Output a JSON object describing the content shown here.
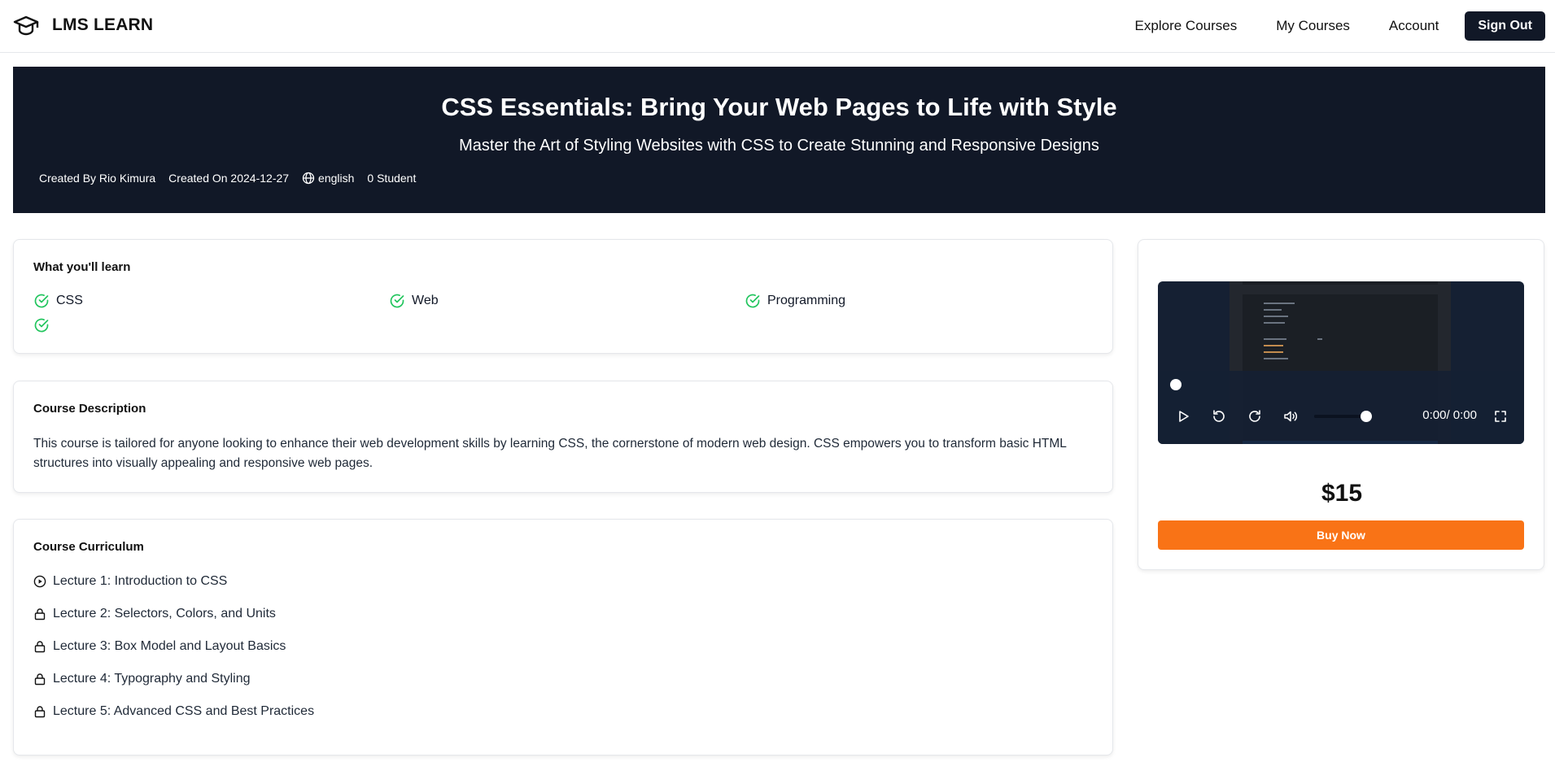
{
  "header": {
    "brand": "LMS LEARN",
    "nav": [
      "Explore Courses",
      "My Courses",
      "Account"
    ],
    "signout_label": "Sign Out"
  },
  "hero": {
    "title": "CSS Essentials: Bring Your Web Pages to Life with Style",
    "subtitle": "Master the Art of Styling Websites with CSS to Create Stunning and Responsive Designs",
    "created_by": "Created By Rio Kimura",
    "created_on": "Created On 2024-12-27",
    "language": "english",
    "students": "0 Student"
  },
  "learn": {
    "title": "What you'll learn",
    "items": [
      "CSS",
      "Web",
      "Programming",
      ""
    ]
  },
  "description": {
    "title": "Course Description",
    "text": "This course is tailored for anyone looking to enhance their web development skills by learning CSS, the cornerstone of modern web design. CSS empowers you to transform basic HTML structures into visually appealing and responsive web pages."
  },
  "curriculum": {
    "title": "Course Curriculum",
    "lectures": [
      {
        "label": "Lecture 1: Introduction to CSS",
        "icon": "play-circle-icon"
      },
      {
        "label": "Lecture 2: Selectors, Colors, and Units",
        "icon": "lock-icon"
      },
      {
        "label": "Lecture 3: Box Model and Layout Basics",
        "icon": "lock-icon"
      },
      {
        "label": "Lecture 4: Typography and Styling",
        "icon": "lock-icon"
      },
      {
        "label": "Lecture 5: Advanced CSS and Best Practices",
        "icon": "lock-icon"
      }
    ]
  },
  "player": {
    "time": "0:00/ 0:00",
    "progress": 0,
    "volume": 1.0
  },
  "purchase": {
    "price": "$15",
    "buy_label": "Buy Now"
  },
  "colors": {
    "hero_bg": "#111827",
    "accent": "#f97316",
    "check": "#22c55e"
  }
}
